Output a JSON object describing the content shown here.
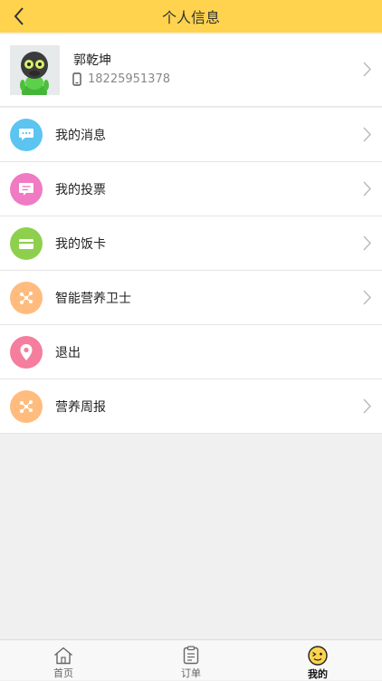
{
  "header": {
    "title": "个人信息",
    "back_icon": "chevron-left-icon"
  },
  "profile": {
    "name": "郭乾坤",
    "phone": "18225951378",
    "phone_icon": "phone-icon"
  },
  "colors": {
    "header": "#ffd34e",
    "messages": "#5cc4f1",
    "votes": "#f07ac3",
    "meal_card": "#8ed04e",
    "guard": "#ffbc7e",
    "logout": "#f57d9e",
    "weekly": "#ffbc7e",
    "active_tab": "#ffd34e"
  },
  "menu": [
    {
      "label": "我的消息",
      "icon": "chat-bubble-icon",
      "has_arrow": true
    },
    {
      "label": "我的投票",
      "icon": "vote-icon",
      "has_arrow": true
    },
    {
      "label": "我的饭卡",
      "icon": "card-icon",
      "has_arrow": true
    },
    {
      "label": "智能营养卫士",
      "icon": "nutrition-icon",
      "has_arrow": true
    },
    {
      "label": "退出",
      "icon": "location-pin-icon",
      "has_arrow": false
    },
    {
      "label": "营养周报",
      "icon": "nutrition-icon",
      "has_arrow": true
    }
  ],
  "tabs": [
    {
      "label": "首页",
      "icon": "home-icon",
      "active": false
    },
    {
      "label": "订单",
      "icon": "order-icon",
      "active": false
    },
    {
      "label": "我的",
      "icon": "smiley-icon",
      "active": true
    }
  ]
}
